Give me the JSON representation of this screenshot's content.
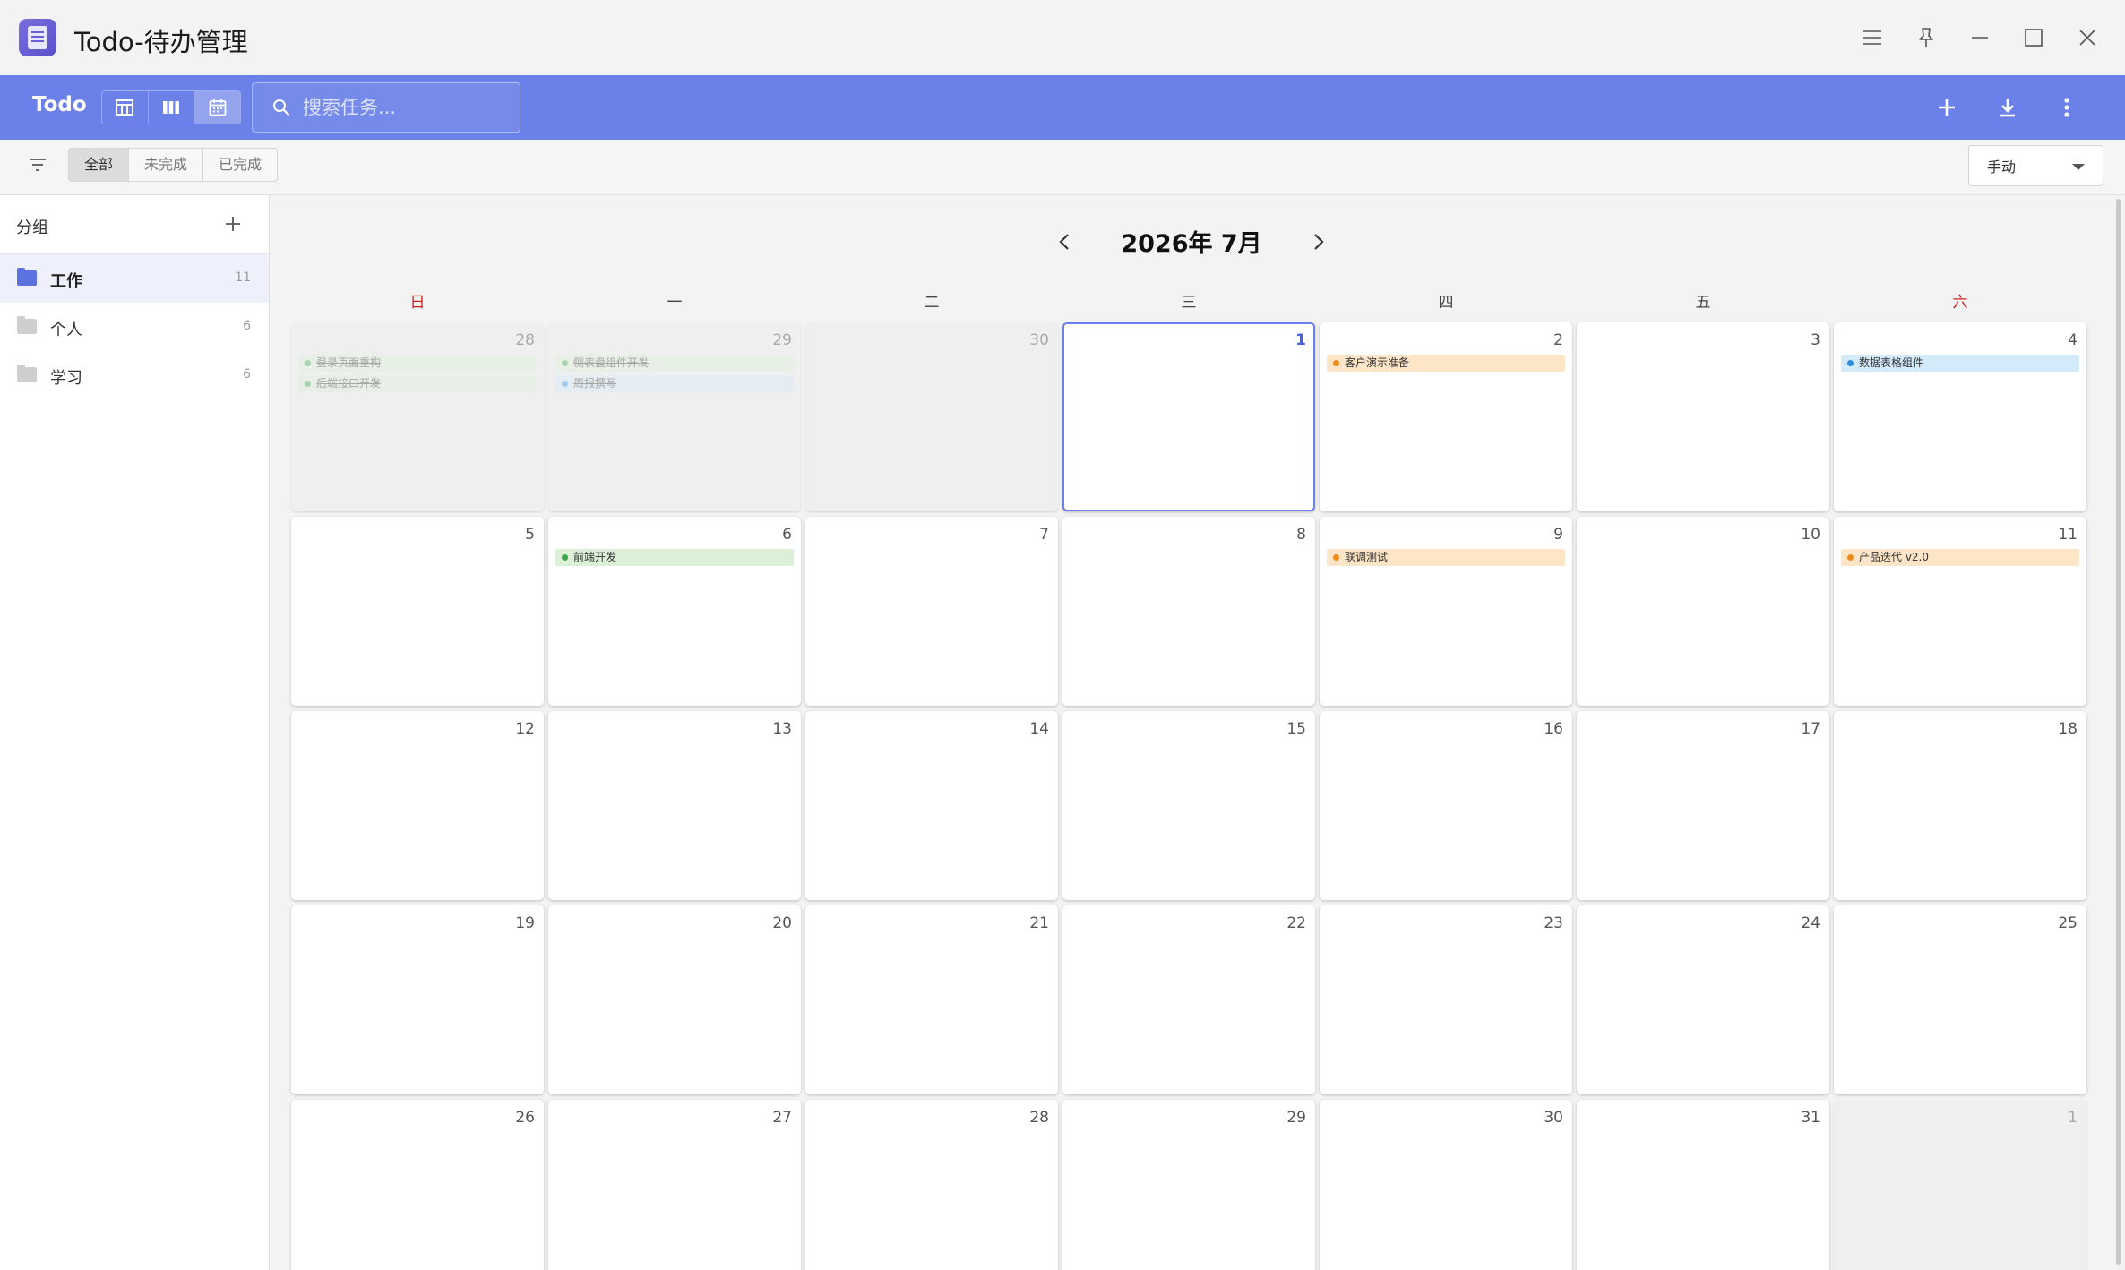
{
  "window": {
    "title": "Todo-待办管理"
  },
  "toolbar": {
    "brand": "Todo",
    "views": [
      {
        "icon": "table-icon",
        "active": false
      },
      {
        "icon": "columns-icon",
        "active": false
      },
      {
        "icon": "calendar-icon",
        "active": true
      }
    ],
    "search_placeholder": "搜索任务...",
    "accent_color": "#6b80e8"
  },
  "filter": {
    "segments": [
      "全部",
      "未完成",
      "已完成"
    ],
    "active_segment": "全部",
    "sort": "手动"
  },
  "sidebar": {
    "title": "分组",
    "groups": [
      {
        "name": "工作",
        "count": "11",
        "color": "#5b72e0",
        "active": true
      },
      {
        "name": "个人",
        "count": "6",
        "color": "#cfcfcf",
        "active": false
      },
      {
        "name": "学习",
        "count": "6",
        "color": "#cfcfcf",
        "active": false
      }
    ]
  },
  "calendar": {
    "title": "2026年 7月",
    "weekdays": [
      "日",
      "一",
      "二",
      "三",
      "四",
      "五",
      "六"
    ],
    "weeks": [
      [
        {
          "day": "28",
          "other": true,
          "tasks": [
            {
              "text": "登录页面重构",
              "color": "green",
              "done": true
            },
            {
              "text": "后端接口开发",
              "color": "green",
              "done": true
            }
          ]
        },
        {
          "day": "29",
          "other": true,
          "tasks": [
            {
              "text": "侧表盘组件开发",
              "color": "green",
              "done": true
            },
            {
              "text": "周报撰写",
              "color": "blue",
              "done": true
            }
          ]
        },
        {
          "day": "30",
          "other": true,
          "tasks": []
        },
        {
          "day": "1",
          "today": true,
          "tasks": []
        },
        {
          "day": "2",
          "tasks": [
            {
              "text": "客户演示准备",
              "color": "orange"
            }
          ]
        },
        {
          "day": "3",
          "tasks": []
        },
        {
          "day": "4",
          "tasks": [
            {
              "text": "数据表格组件",
              "color": "blue"
            }
          ]
        }
      ],
      [
        {
          "day": "5",
          "tasks": []
        },
        {
          "day": "6",
          "tasks": [
            {
              "text": "前端开发",
              "color": "green"
            }
          ]
        },
        {
          "day": "7",
          "tasks": []
        },
        {
          "day": "8",
          "tasks": []
        },
        {
          "day": "9",
          "tasks": [
            {
              "text": "联调测试",
              "color": "orange"
            }
          ]
        },
        {
          "day": "10",
          "tasks": []
        },
        {
          "day": "11",
          "tasks": [
            {
              "text": "产品迭代 v2.0",
              "color": "orange"
            }
          ]
        }
      ],
      [
        {
          "day": "12",
          "tasks": []
        },
        {
          "day": "13",
          "tasks": []
        },
        {
          "day": "14",
          "tasks": []
        },
        {
          "day": "15",
          "tasks": []
        },
        {
          "day": "16",
          "tasks": []
        },
        {
          "day": "17",
          "tasks": []
        },
        {
          "day": "18",
          "tasks": []
        }
      ],
      [
        {
          "day": "19",
          "tasks": []
        },
        {
          "day": "20",
          "tasks": []
        },
        {
          "day": "21",
          "tasks": []
        },
        {
          "day": "22",
          "tasks": []
        },
        {
          "day": "23",
          "tasks": []
        },
        {
          "day": "24",
          "tasks": []
        },
        {
          "day": "25",
          "tasks": []
        }
      ],
      [
        {
          "day": "26",
          "tasks": []
        },
        {
          "day": "27",
          "tasks": []
        },
        {
          "day": "28",
          "tasks": []
        },
        {
          "day": "29",
          "tasks": []
        },
        {
          "day": "30",
          "tasks": []
        },
        {
          "day": "31",
          "tasks": []
        },
        {
          "day": "1",
          "other": true,
          "tasks": []
        }
      ]
    ]
  }
}
